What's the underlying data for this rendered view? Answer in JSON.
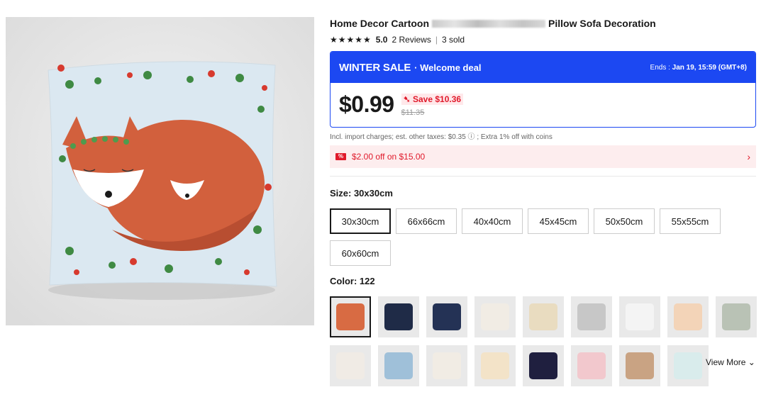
{
  "product": {
    "title_start": "Home Decor Cartoon",
    "title_end": "Pillow Sofa Decoration",
    "rating_stars": "★★★★★",
    "rating_score": "5.0",
    "reviews": "2 Reviews",
    "sold": "3 sold"
  },
  "sale": {
    "name": "WINTER SALE",
    "subtitle": "· Welcome deal",
    "ends_label": "Ends :",
    "ends_value": "Jan 19, 15:59 (GMT+8)",
    "price": "$0.99",
    "save": "Save $10.36",
    "original_price": "$11.35",
    "accent": "#1c48f2"
  },
  "taxes": "Incl. import charges; est. other taxes: $0.35 ⓘ ; Extra 1% off with coins",
  "coupon": {
    "label": "$2.00 off on $15.00",
    "tag": "%",
    "arrow": "›"
  },
  "size": {
    "label": "Size: 30x30cm",
    "options": [
      "30x30cm",
      "66x66cm",
      "40x40cm",
      "45x45cm",
      "50x50cm",
      "55x55cm",
      "60x60cm"
    ],
    "selected_index": 0
  },
  "color": {
    "label": "Color: 122",
    "swatches": [
      {
        "icon": "fox-pillow-icon",
        "color": "#d86b43"
      },
      {
        "icon": "wreath-pillow-icon",
        "color": "#1f2b47"
      },
      {
        "icon": "navy-fox-pillow-icon",
        "color": "#243255"
      },
      {
        "icon": "white-fox-pillow-icon",
        "color": "#f1ece4"
      },
      {
        "icon": "pattern-pillow-icon",
        "color": "#e9dcc0"
      },
      {
        "icon": "grey-fox-pillow-icon",
        "color": "#c7c7c7"
      },
      {
        "icon": "cat-pillow-icon",
        "color": "#f4f4f4"
      },
      {
        "icon": "peach-fox-pillow-icon",
        "color": "#f3d4b8"
      },
      {
        "icon": "sage-pillow-icon",
        "color": "#b9c2b5"
      },
      {
        "icon": "fox-white-pillow-icon",
        "color": "#f0ebe5"
      },
      {
        "icon": "blue-fox-pillow-icon",
        "color": "#9fc0d9"
      },
      {
        "icon": "trees-pillow-icon",
        "color": "#f1ece4"
      },
      {
        "icon": "cream-fox-pillow-icon",
        "color": "#f3e3c8"
      },
      {
        "icon": "dark-fox-pillow-icon",
        "color": "#1f1f3f"
      },
      {
        "icon": "pink-fox-pillow-icon",
        "color": "#f2c8cd"
      },
      {
        "icon": "brown-fox-pillow-icon",
        "color": "#c9a383"
      },
      {
        "icon": "mint-fox-pillow-icon",
        "color": "#d9ecec"
      }
    ],
    "selected_index": 0,
    "view_more": "View More ⌄"
  }
}
